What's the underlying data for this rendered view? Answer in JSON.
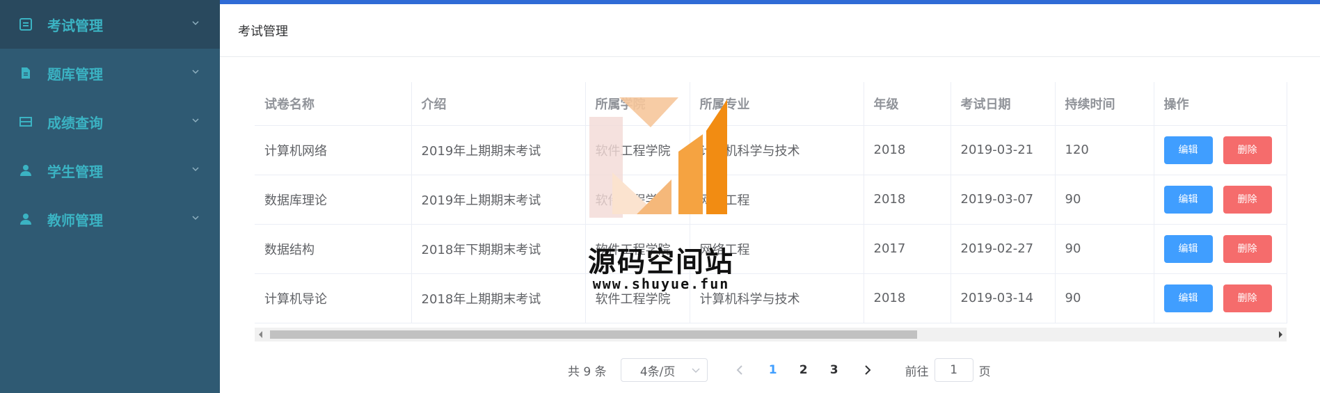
{
  "sidebar": {
    "items": [
      {
        "label": "考试管理",
        "icon": "document-icon"
      },
      {
        "label": "题库管理",
        "icon": "file-icon"
      },
      {
        "label": "成绩查询",
        "icon": "chart-icon"
      },
      {
        "label": "学生管理",
        "icon": "user-icon"
      },
      {
        "label": "教师管理",
        "icon": "user-icon"
      }
    ]
  },
  "breadcrumb": {
    "title": "考试管理"
  },
  "table": {
    "headers": [
      "试卷名称",
      "介绍",
      "所属学院",
      "所属专业",
      "年级",
      "考试日期",
      "持续时间",
      "操作"
    ],
    "rows": [
      [
        "计算机网络",
        "2019年上期期末考试",
        "软件工程学院",
        "计算机科学与技术",
        "2018",
        "2019-03-21",
        "120"
      ],
      [
        "数据库理论",
        "2019年上期期末考试",
        "软件工程学院",
        "网络工程",
        "2018",
        "2019-03-07",
        "90"
      ],
      [
        "数据结构",
        "2018年下期期末考试",
        "软件工程学院",
        "网络工程",
        "2017",
        "2019-02-27",
        "90"
      ],
      [
        "计算机导论",
        "2018年上期期末考试",
        "软件工程学院",
        "计算机科学与技术",
        "2018",
        "2019-03-14",
        "90"
      ]
    ],
    "edit_label": "编辑",
    "delete_label": "删除"
  },
  "pagination": {
    "total": "共 9 条",
    "page_size": "4条/页",
    "pages": [
      "1",
      "2",
      "3"
    ],
    "current": "1",
    "goto_prefix": "前往",
    "goto_value": "1",
    "goto_suffix": "页"
  },
  "watermark": {
    "text": "源码空间站",
    "url": "www.shuyue.fun"
  },
  "colors": {
    "accent": "#409eff",
    "danger": "#f56c6c",
    "sidebar": "#2f5a73",
    "sidebar_text": "#3bb3c3"
  }
}
